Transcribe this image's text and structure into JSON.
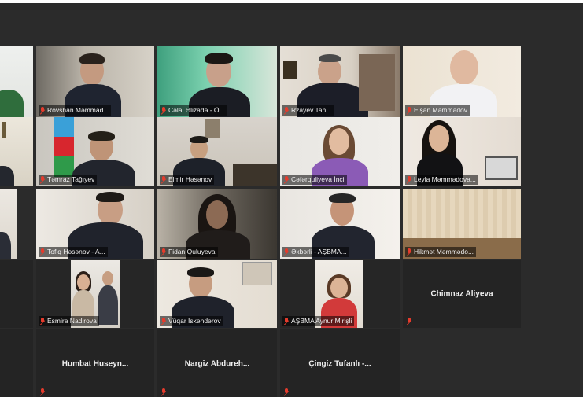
{
  "participants": [
    {
      "name": "",
      "muted": true
    },
    {
      "name": "Rövshan Məmmad...",
      "muted": true
    },
    {
      "name": "Cəlal Əlizadə - Ö...",
      "muted": true
    },
    {
      "name": "Rzayev Tah...",
      "muted": true,
      "active": true
    },
    {
      "name": "Elşən Məmmədov",
      "muted": true
    },
    {
      "name": "",
      "muted": true
    },
    {
      "name": "Təmraz Tağıyev",
      "muted": true
    },
    {
      "name": "Elmir Həsənov",
      "muted": true
    },
    {
      "name": "Cəfərquliyeva İnci",
      "muted": true
    },
    {
      "name": "Leyla Məmmədova...",
      "muted": true
    },
    {
      "name": "",
      "muted": true
    },
    {
      "name": "Tofiq Həsənov - A...",
      "muted": true
    },
    {
      "name": "Fidan Quluyeva",
      "muted": true
    },
    {
      "name": "Əkbərli - AŞBMA...",
      "muted": true
    },
    {
      "name": "Hikmət Məmmədo...",
      "muted": true
    },
    {
      "name": "",
      "muted": true
    },
    {
      "name": "Esmira Nadirova",
      "muted": true
    },
    {
      "name": "Vüqar İskəndərov",
      "muted": true
    },
    {
      "name": "AŞBMA Aynur Mirişli",
      "muted": true
    },
    {
      "name": "Chimnaz Aliyeva",
      "muted": true
    },
    {
      "name": "Humbat Huseyn...",
      "muted": true
    },
    {
      "name": "Nargiz Abdureh...",
      "muted": true
    },
    {
      "name": "Çingiz Tufanlı -...",
      "muted": true
    }
  ],
  "colors": {
    "background": "#2b2b2b",
    "active_border": "#d6d63a",
    "mute_icon": "#e53b2c"
  }
}
